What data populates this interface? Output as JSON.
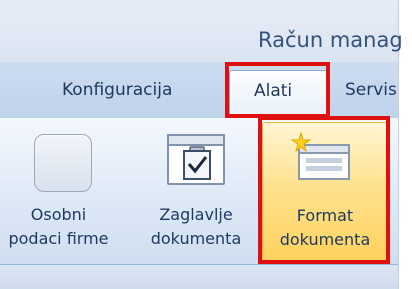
{
  "window": {
    "title": "Račun manag"
  },
  "tabs": [
    {
      "label": "Konfiguracija"
    },
    {
      "label": "Alati",
      "selected": true
    },
    {
      "label": "Servis"
    }
  ],
  "ribbon": {
    "buttons": [
      {
        "line1": "Osobni",
        "line2": "podaci firme",
        "icon": "blank-button-icon"
      },
      {
        "line1": "Zaglavlje",
        "line2": "dokumenta",
        "icon": "clipboard-check-icon"
      },
      {
        "line1": "Format",
        "line2": "dokumenta",
        "icon": "document-format-icon",
        "hovered": true
      }
    ]
  },
  "colors": {
    "highlight_border": "#e01010",
    "hover_fill": "#ffe28f",
    "text": "#1f3a60"
  }
}
